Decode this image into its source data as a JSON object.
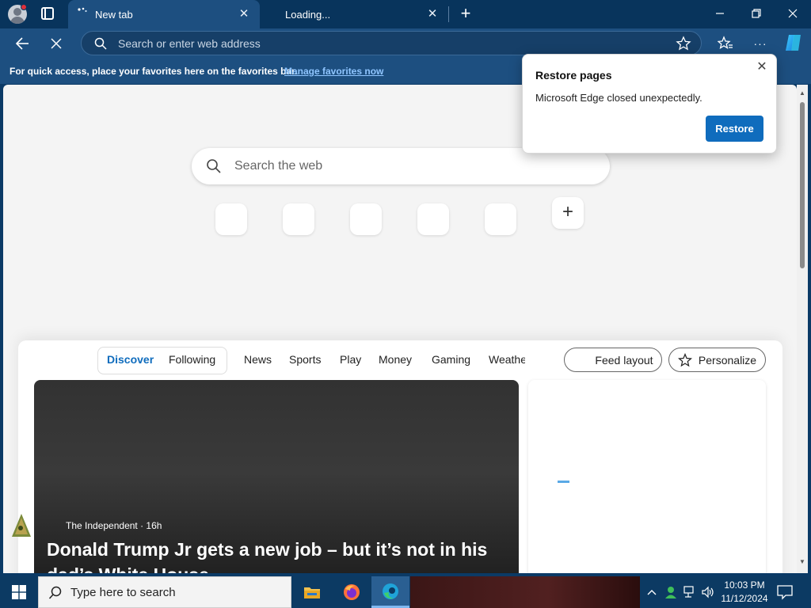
{
  "browser": {
    "tabs": [
      {
        "label": "New tab"
      },
      {
        "label": "Loading..."
      }
    ],
    "address_placeholder": "Search or enter web address"
  },
  "favorites_bar": {
    "message": "For quick access, place your favorites here on the favorites bar.",
    "link": "Manage favorites now"
  },
  "newtab": {
    "search_placeholder": "Search the web",
    "add_tile": "+"
  },
  "feed": {
    "pivots": [
      "Discover",
      "Following"
    ],
    "categories": [
      "News",
      "Sports",
      "Play",
      "Money",
      "Gaming",
      "Weathe"
    ],
    "feed_layout": "Feed layout",
    "personalize": "Personalize",
    "hero": {
      "source": "The Independent · 16h",
      "headline": "Donald Trump Jr gets a new job – but it’s not in his dad’s White House"
    }
  },
  "popup": {
    "title": "Restore pages",
    "message": "Microsoft Edge closed unexpectedly.",
    "button": "Restore"
  },
  "taskbar": {
    "search": "Type here to search",
    "time": "10:03 PM",
    "date": "11/12/2024"
  },
  "colors": {
    "accent": "#0f6cbd",
    "titlebar": "#08345c",
    "toolbar": "#1d4f80",
    "link": "#8fc5ff"
  }
}
